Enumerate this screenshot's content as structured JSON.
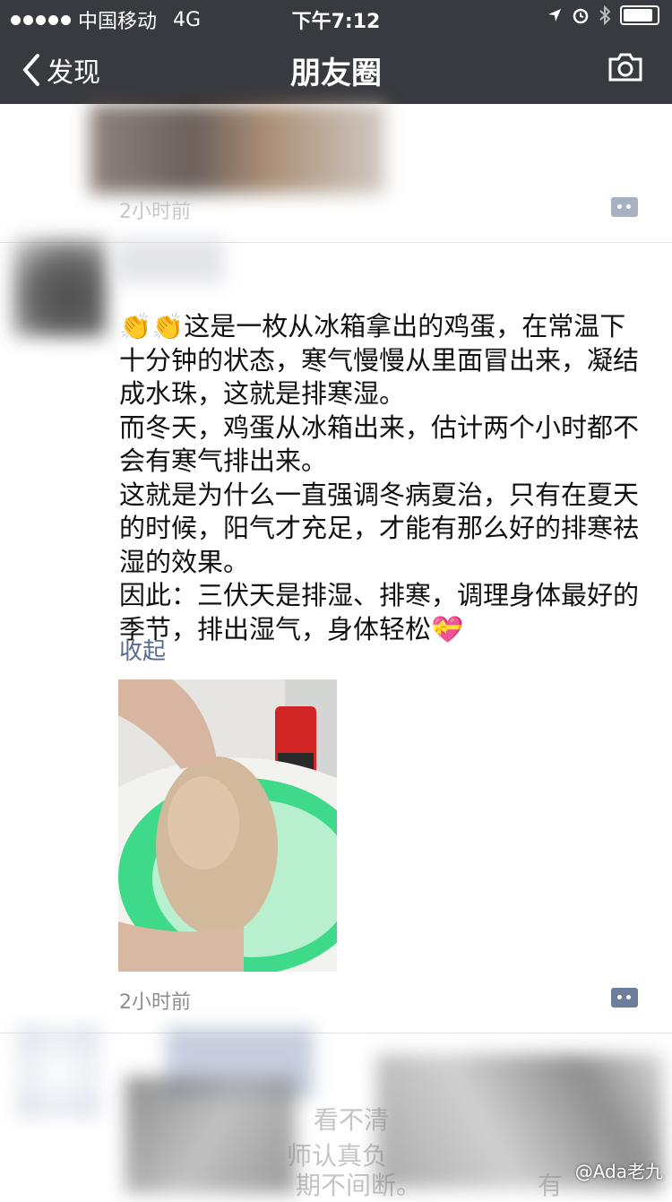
{
  "status_bar": {
    "carrier": "中国移动",
    "network": "4G",
    "time": "下午7:12"
  },
  "nav": {
    "back_label": "发现",
    "title": "朋友圈",
    "icons": [
      "chevron-left-icon",
      "camera-icon"
    ]
  },
  "posts": [
    {
      "time": "2小时前"
    },
    {
      "text": "👏👏这是一枚从冰箱拿出的鸡蛋，在常温下十分钟的状态，寒气慢慢从里面冒出来，凝结成水珠，这就是排寒湿。\n而冬天，鸡蛋从冰箱出来，估计两个小时都不会有寒气排出来。\n这就是为什么一直强调冬病夏治，只有在夏天的时候，阳气才充足，才能有那么好的排寒祛湿的效果。\n因此：三伏天是排湿、排寒，调理身体最好的季节，排出湿气，身体轻松💝",
      "collapse_label": "收起",
      "time": "2小时前"
    },
    {
      "visible_fragments": [
        "看不清",
        "师认真负",
        "期不间断。",
        "有"
      ]
    }
  ],
  "watermark": "@Ada老九"
}
